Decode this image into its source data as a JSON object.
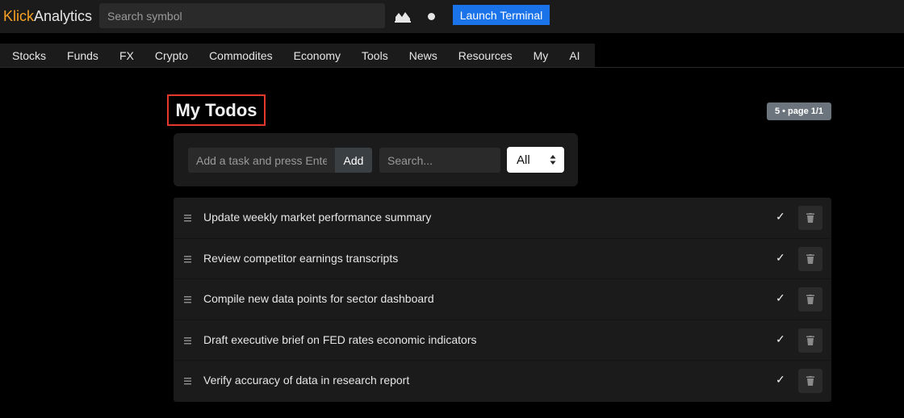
{
  "header": {
    "logo_part1": "Klick",
    "logo_part2": "Analytics",
    "search_placeholder": "Search symbol",
    "launch_label": "Launch Terminal",
    "icons": [
      "chart-icon",
      "dot-icon"
    ]
  },
  "nav": {
    "items": [
      "Stocks",
      "Funds",
      "FX",
      "Crypto",
      "Commodites",
      "Economy",
      "Tools",
      "News",
      "Resources",
      "My",
      "AI"
    ]
  },
  "page": {
    "title": "My Todos",
    "badge": "5 • page 1/1"
  },
  "controls": {
    "task_placeholder": "Add a task and press Enter",
    "add_label": "Add",
    "search_placeholder": "Search...",
    "filter_value": "All"
  },
  "todos": [
    {
      "text": "Update weekly market performance summary",
      "check": "✓"
    },
    {
      "text": "Review competitor earnings transcripts",
      "check": "✓"
    },
    {
      "text": "Compile new data points for sector dashboard",
      "check": "✓"
    },
    {
      "text": "Draft executive brief on FED rates economic indicators",
      "check": "✓"
    },
    {
      "text": "Verify accuracy of data in research report",
      "check": "✓"
    }
  ],
  "colors": {
    "brand_orange": "#f7a124",
    "accent_blue": "#1a73e8",
    "highlight_red": "#e5372b",
    "badge_gray": "#6c757d"
  }
}
